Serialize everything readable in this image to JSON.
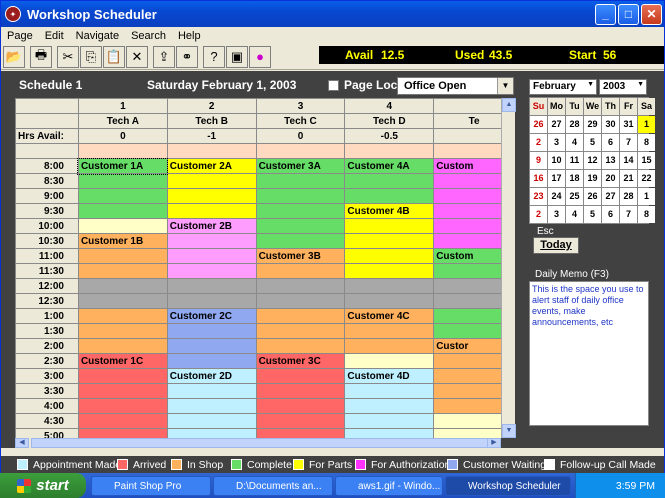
{
  "window": {
    "title": "Workshop Scheduler"
  },
  "menu": [
    "Page",
    "Edit",
    "Navigate",
    "Search",
    "Help"
  ],
  "toolbar": [
    "open-icon",
    "print-icon",
    "cut-icon",
    "copy-icon",
    "paste-icon",
    "delete-icon",
    "export-icon",
    "binoculars-icon",
    "help-icon",
    "calendar-icon",
    "info-icon"
  ],
  "stats": {
    "avail_label": "Avail",
    "avail_value": "12.5",
    "used_label": "Used",
    "used_value": "43.5",
    "start_label": "Start",
    "start_value": "56"
  },
  "schedule": {
    "name": "Schedule 1",
    "date": "Saturday  February 1,  2003",
    "page_lock_label": "Page Lock",
    "office_status": "Office Open",
    "columns": [
      {
        "num": "1",
        "tech": "Tech A",
        "hrs": "0"
      },
      {
        "num": "2",
        "tech": "Tech B",
        "hrs": "-1"
      },
      {
        "num": "3",
        "tech": "Tech C",
        "hrs": "0"
      },
      {
        "num": "4",
        "tech": "Tech D",
        "hrs": "-0.5"
      },
      {
        "num": "",
        "tech": "Te",
        "hrs": ""
      }
    ],
    "hrs_label": "Hrs Avail:",
    "times": [
      "8:00",
      "8:30",
      "9:00",
      "9:30",
      "10:00",
      "10:30",
      "11:00",
      "11:30",
      "12:00",
      "12:30",
      "1:00",
      "1:30",
      "2:00",
      "2:30",
      "3:00",
      "3:30",
      "4:00",
      "4:30",
      "5:00"
    ],
    "cells": [
      [
        {
          "c": "#66dd66",
          "t": "Customer 1A"
        },
        {
          "c": "#ffff00",
          "t": "Customer 2A"
        },
        {
          "c": "#66dd66",
          "t": "Customer 3A"
        },
        {
          "c": "#66dd66",
          "t": "Customer 4A"
        },
        {
          "c": "#ff66ff",
          "t": "Custom"
        }
      ],
      [
        {
          "c": "#66dd66",
          "t": ""
        },
        {
          "c": "#ffff00",
          "t": ""
        },
        {
          "c": "#66dd66",
          "t": ""
        },
        {
          "c": "#66dd66",
          "t": ""
        },
        {
          "c": "#ff66ff",
          "t": ""
        }
      ],
      [
        {
          "c": "#66dd66",
          "t": ""
        },
        {
          "c": "#ffff00",
          "t": ""
        },
        {
          "c": "#66dd66",
          "t": ""
        },
        {
          "c": "#66dd66",
          "t": ""
        },
        {
          "c": "#ff66ff",
          "t": ""
        }
      ],
      [
        {
          "c": "#66dd66",
          "t": ""
        },
        {
          "c": "#ffff00",
          "t": ""
        },
        {
          "c": "#66dd66",
          "t": ""
        },
        {
          "c": "#ffff00",
          "t": "Customer 4B"
        },
        {
          "c": "#ff66ff",
          "t": ""
        }
      ],
      [
        {
          "c": "#ffffc8",
          "t": ""
        },
        {
          "c": "#ff9dff",
          "t": "Customer 2B"
        },
        {
          "c": "#66dd66",
          "t": ""
        },
        {
          "c": "#ffff00",
          "t": ""
        },
        {
          "c": "#ff66ff",
          "t": ""
        }
      ],
      [
        {
          "c": "#ffb15e",
          "t": "Customer 1B"
        },
        {
          "c": "#ff9dff",
          "t": ""
        },
        {
          "c": "#66dd66",
          "t": ""
        },
        {
          "c": "#ffff00",
          "t": ""
        },
        {
          "c": "#ff66ff",
          "t": ""
        }
      ],
      [
        {
          "c": "#ffb15e",
          "t": ""
        },
        {
          "c": "#ff9dff",
          "t": ""
        },
        {
          "c": "#ffb15e",
          "t": "Customer 3B"
        },
        {
          "c": "#ffff00",
          "t": ""
        },
        {
          "c": "#66dd66",
          "t": "Custom"
        }
      ],
      [
        {
          "c": "#ffb15e",
          "t": ""
        },
        {
          "c": "#ff9dff",
          "t": ""
        },
        {
          "c": "#ffb15e",
          "t": ""
        },
        {
          "c": "#ffff00",
          "t": ""
        },
        {
          "c": "#66dd66",
          "t": ""
        }
      ],
      [
        {
          "c": "#a8a8a8",
          "t": ""
        },
        {
          "c": "#a8a8a8",
          "t": ""
        },
        {
          "c": "#a8a8a8",
          "t": ""
        },
        {
          "c": "#a8a8a8",
          "t": ""
        },
        {
          "c": "#a8a8a8",
          "t": ""
        }
      ],
      [
        {
          "c": "#a8a8a8",
          "t": ""
        },
        {
          "c": "#a8a8a8",
          "t": ""
        },
        {
          "c": "#a8a8a8",
          "t": ""
        },
        {
          "c": "#a8a8a8",
          "t": ""
        },
        {
          "c": "#a8a8a8",
          "t": ""
        }
      ],
      [
        {
          "c": "#ffb15e",
          "t": ""
        },
        {
          "c": "#8fa8f0",
          "t": "Customer 2C"
        },
        {
          "c": "#ffb15e",
          "t": ""
        },
        {
          "c": "#ffb15e",
          "t": "Customer 4C"
        },
        {
          "c": "#66dd66",
          "t": ""
        }
      ],
      [
        {
          "c": "#ffb15e",
          "t": ""
        },
        {
          "c": "#8fa8f0",
          "t": ""
        },
        {
          "c": "#ffb15e",
          "t": ""
        },
        {
          "c": "#ffb15e",
          "t": ""
        },
        {
          "c": "#66dd66",
          "t": ""
        }
      ],
      [
        {
          "c": "#ffb15e",
          "t": ""
        },
        {
          "c": "#8fa8f0",
          "t": ""
        },
        {
          "c": "#ffb15e",
          "t": ""
        },
        {
          "c": "#ffb15e",
          "t": ""
        },
        {
          "c": "#ffb15e",
          "t": "Custor"
        }
      ],
      [
        {
          "c": "#ff6666",
          "t": "Customer 1C"
        },
        {
          "c": "#8fa8f0",
          "t": ""
        },
        {
          "c": "#ff6666",
          "t": "Customer 3C"
        },
        {
          "c": "#ffffc8",
          "t": ""
        },
        {
          "c": "#ffb15e",
          "t": ""
        }
      ],
      [
        {
          "c": "#ff6666",
          "t": ""
        },
        {
          "c": "#bff0ff",
          "t": "Customer 2D"
        },
        {
          "c": "#ff6666",
          "t": ""
        },
        {
          "c": "#bff0ff",
          "t": "Customer 4D"
        },
        {
          "c": "#ffb15e",
          "t": ""
        }
      ],
      [
        {
          "c": "#ff6666",
          "t": ""
        },
        {
          "c": "#bff0ff",
          "t": ""
        },
        {
          "c": "#ff6666",
          "t": ""
        },
        {
          "c": "#bff0ff",
          "t": ""
        },
        {
          "c": "#ffb15e",
          "t": ""
        }
      ],
      [
        {
          "c": "#ff6666",
          "t": ""
        },
        {
          "c": "#bff0ff",
          "t": ""
        },
        {
          "c": "#ff6666",
          "t": ""
        },
        {
          "c": "#bff0ff",
          "t": ""
        },
        {
          "c": "#ffb15e",
          "t": ""
        }
      ],
      [
        {
          "c": "#ff6666",
          "t": ""
        },
        {
          "c": "#bff0ff",
          "t": ""
        },
        {
          "c": "#ff6666",
          "t": ""
        },
        {
          "c": "#bff0ff",
          "t": ""
        },
        {
          "c": "#ffffc8",
          "t": ""
        }
      ],
      [
        {
          "c": "#ff6666",
          "t": ""
        },
        {
          "c": "#bff0ff",
          "t": ""
        },
        {
          "c": "#ff6666",
          "t": ""
        },
        {
          "c": "#bff0ff",
          "t": ""
        },
        {
          "c": "#ffffc8",
          "t": ""
        }
      ]
    ]
  },
  "calendar": {
    "month": "February",
    "year": "2003",
    "days": [
      "Su",
      "Mo",
      "Tu",
      "We",
      "Th",
      "Fr",
      "Sa"
    ],
    "weeks": [
      [
        "26",
        "27",
        "28",
        "29",
        "30",
        "31",
        "1"
      ],
      [
        "2",
        "3",
        "4",
        "5",
        "6",
        "7",
        "8"
      ],
      [
        "9",
        "10",
        "11",
        "12",
        "13",
        "14",
        "15"
      ],
      [
        "16",
        "17",
        "18",
        "19",
        "20",
        "21",
        "22"
      ],
      [
        "23",
        "24",
        "25",
        "26",
        "27",
        "28",
        "1"
      ],
      [
        "2",
        "3",
        "4",
        "5",
        "6",
        "7",
        "8"
      ]
    ],
    "today_label": "Today",
    "esc_label": "Esc"
  },
  "memo": {
    "label": "Daily Memo  (F3)",
    "text": "This is the space you use to alert staff of daily office events, make announcements, etc"
  },
  "legend": [
    {
      "label": "Appointment Made",
      "color": "#bff0ff"
    },
    {
      "label": "Arrived",
      "color": "#ff6666"
    },
    {
      "label": "In Shop",
      "color": "#ffb15e"
    },
    {
      "label": "Complete",
      "color": "#66dd66"
    },
    {
      "label": "For Parts",
      "color": "#ffff00"
    },
    {
      "label": "For Authorization",
      "color": "#ff33ff"
    },
    {
      "label": "Customer Waiting",
      "color": "#8fa8f0"
    },
    {
      "label": "Follow-up Call Made",
      "color": "#ffffff"
    }
  ],
  "taskbar": {
    "start": "start",
    "tasks": [
      "Paint Shop Pro",
      "D:\\Documents an...",
      "aws1.gif - Windo...",
      "Workshop Scheduler"
    ],
    "clock": "3:59 PM"
  }
}
